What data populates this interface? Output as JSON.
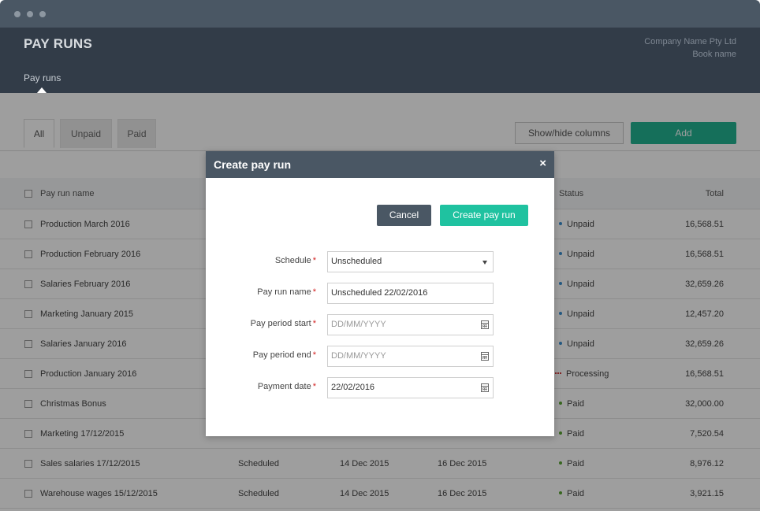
{
  "app": {
    "page_title": "PAY RUNS",
    "company_name": "Company Name Pty Ltd",
    "book_name": "Book name",
    "nav_tab": "Pay runs"
  },
  "filters": {
    "tabs": [
      "All",
      "Unpaid",
      "Paid"
    ],
    "active": "All",
    "show_hide_label": "Show/hide columns",
    "add_label": "Add"
  },
  "table": {
    "headers": {
      "name": "Pay run name",
      "status": "Status",
      "total": "Total"
    },
    "rows": [
      {
        "name": "Production March 2016",
        "schedule": "",
        "start": "",
        "end": "",
        "status": "Unpaid",
        "total": "16,568.51"
      },
      {
        "name": "Production February 2016",
        "schedule": "",
        "start": "",
        "end": "",
        "status": "Unpaid",
        "total": "16,568.51"
      },
      {
        "name": "Salaries February 2016",
        "schedule": "",
        "start": "",
        "end": "",
        "status": "Unpaid",
        "total": "32,659.26"
      },
      {
        "name": "Marketing January 2015",
        "schedule": "",
        "start": "",
        "end": "",
        "status": "Unpaid",
        "total": "12,457.20"
      },
      {
        "name": "Salaries January 2016",
        "schedule": "",
        "start": "",
        "end": "",
        "status": "Unpaid",
        "total": "32,659.26"
      },
      {
        "name": "Production January 2016",
        "schedule": "",
        "start": "",
        "end": "",
        "status": "Processing",
        "total": "16,568.51"
      },
      {
        "name": "Christmas Bonus",
        "schedule": "",
        "start": "",
        "end": "",
        "status": "Paid",
        "total": "32,000.00"
      },
      {
        "name": "Marketing 17/12/2015",
        "schedule": "",
        "start": "",
        "end": "",
        "status": "Paid",
        "total": "7,520.54"
      },
      {
        "name": "Sales salaries 17/12/2015",
        "schedule": "Scheduled",
        "start": "14 Dec 2015",
        "end": "16 Dec 2015",
        "status": "Paid",
        "total": "8,976.12"
      },
      {
        "name": "Warehouse wages 15/12/2015",
        "schedule": "Scheduled",
        "start": "14 Dec 2015",
        "end": "16 Dec 2015",
        "status": "Paid",
        "total": "3,921.15"
      }
    ]
  },
  "status_colors": {
    "Unpaid": "#3a8fd1",
    "Paid": "#5aa532",
    "Processing": "#d23a3a"
  },
  "modal": {
    "title": "Create pay run",
    "close_icon": "×",
    "cancel_label": "Cancel",
    "create_label": "Create pay run",
    "fields": {
      "schedule": {
        "label": "Schedule",
        "value": "Unscheduled"
      },
      "name": {
        "label": "Pay run name",
        "value": "Unscheduled 22/02/2016"
      },
      "period_start": {
        "label": "Pay period start",
        "placeholder": "DD/MM/YYYY"
      },
      "period_end": {
        "label": "Pay period end",
        "placeholder": "DD/MM/YYYY"
      },
      "payment_date": {
        "label": "Payment date",
        "value": "22/02/2016"
      }
    },
    "required_mark": "*"
  }
}
